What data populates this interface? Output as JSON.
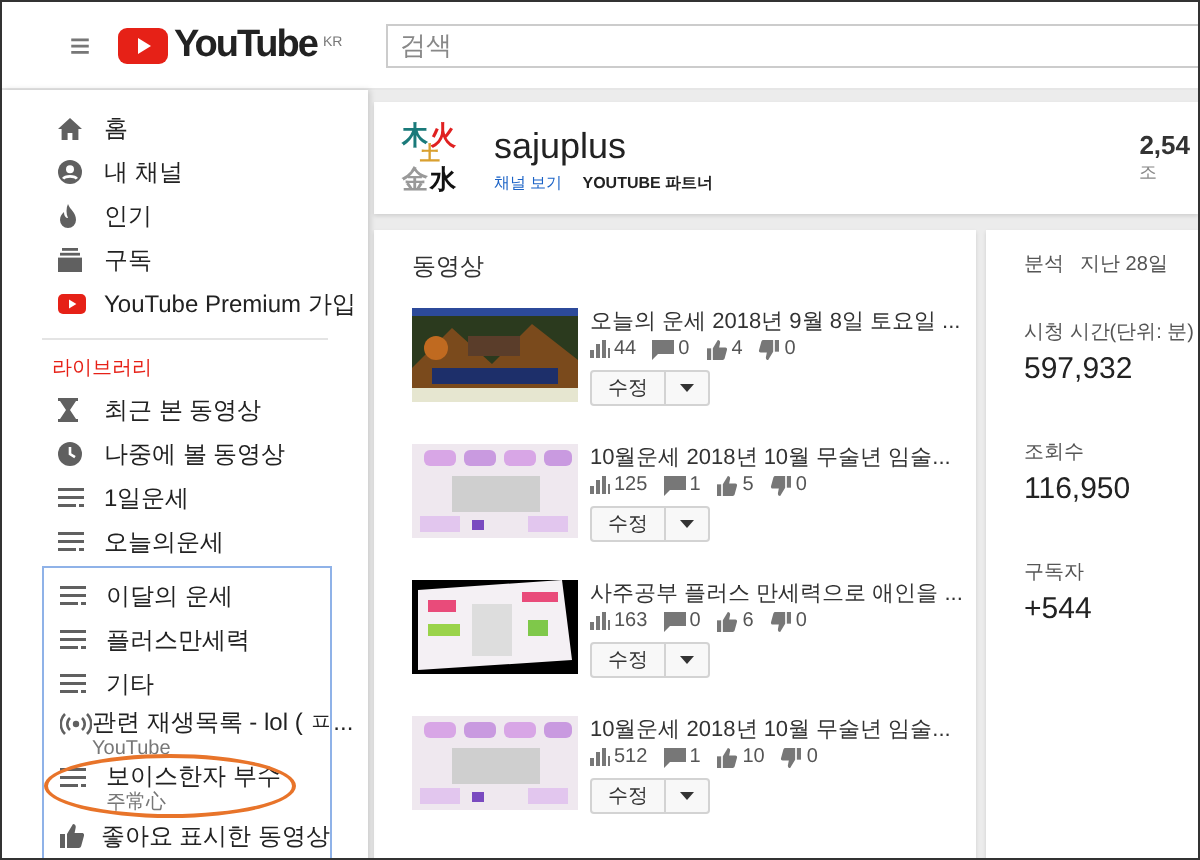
{
  "header": {
    "menu_icon": "≡",
    "logo_text": "YouTube",
    "region": "KR",
    "search": {
      "placeholder": "검색"
    }
  },
  "sidebar": {
    "main_items": [
      {
        "label": "홈",
        "kind": "home"
      },
      {
        "label": "내 채널",
        "kind": "channel"
      },
      {
        "label": "인기",
        "kind": "trending"
      },
      {
        "label": "구독",
        "kind": "subscriptions"
      },
      {
        "label": "YouTube Premium 가입",
        "kind": "premium"
      }
    ],
    "library_heading": "라이브러리",
    "library_items": [
      {
        "label": "최근 본 동영상",
        "kind": "history"
      },
      {
        "label": "나중에 볼 동영상",
        "kind": "later"
      },
      {
        "label": "1일운세",
        "kind": "playlist"
      },
      {
        "label": "오늘의운세",
        "kind": "playlist"
      }
    ],
    "framed_items": [
      {
        "label": "이달의 운세",
        "kind": "playlist",
        "circled": false
      },
      {
        "label": "플러스만세력",
        "kind": "playlist",
        "circled": false
      },
      {
        "label": "기타",
        "kind": "playlist",
        "circled": false
      },
      {
        "label": "관련 재생목록 - lol ( ㅍ...",
        "subtitle": "YouTube",
        "kind": "mix",
        "circled": false
      },
      {
        "label": "보이스한자 부수",
        "subtitle": "주常心",
        "kind": "playlist",
        "circled": true
      },
      {
        "label": "좋아요 표시한 동영상",
        "kind": "liked",
        "circled": false
      }
    ]
  },
  "channel": {
    "logo_chars": [
      {
        "char": "木",
        "color": "#1a7a7a"
      },
      {
        "char": "火",
        "color": "#e02020"
      },
      {
        "char": "土",
        "color": "#d9a030"
      },
      {
        "char": "金",
        "color": "#999999"
      },
      {
        "char": "水",
        "color": "#111111"
      }
    ],
    "name": "sajuplus",
    "view_link": "채널 보기",
    "partner": "YOUTUBE 파트너",
    "subscriber_count": "2,54",
    "subscriber_label": "조"
  },
  "videos": {
    "title": "동영상",
    "items": [
      {
        "title": "오늘의 운세 2018년 9월 8일 토요일 ...",
        "views": "44",
        "comments": "0",
        "likes": "4",
        "dislikes": "0",
        "edit_button": "수정"
      },
      {
        "title": "10월운세 2018년 10월 무술년 임술...",
        "views": "125",
        "comments": "1",
        "likes": "5",
        "dislikes": "0",
        "edit_button": "수정"
      },
      {
        "title": "사주공부 플러스 만세력으로 애인을 ...",
        "views": "163",
        "comments": "0",
        "likes": "6",
        "dislikes": "0",
        "edit_button": "수정"
      },
      {
        "title": "10월운세 2018년 10월 무술년 임술...",
        "views": "512",
        "comments": "1",
        "likes": "10",
        "dislikes": "0",
        "edit_button": "수정"
      }
    ]
  },
  "analytics": {
    "title": "분석",
    "period": "지난 28일",
    "metrics": [
      {
        "label": "시청 시간(단위: 분)",
        "value": "597,932"
      },
      {
        "label": "조회수",
        "value": "116,950"
      },
      {
        "label": "구독자",
        "value": "+544"
      }
    ]
  }
}
